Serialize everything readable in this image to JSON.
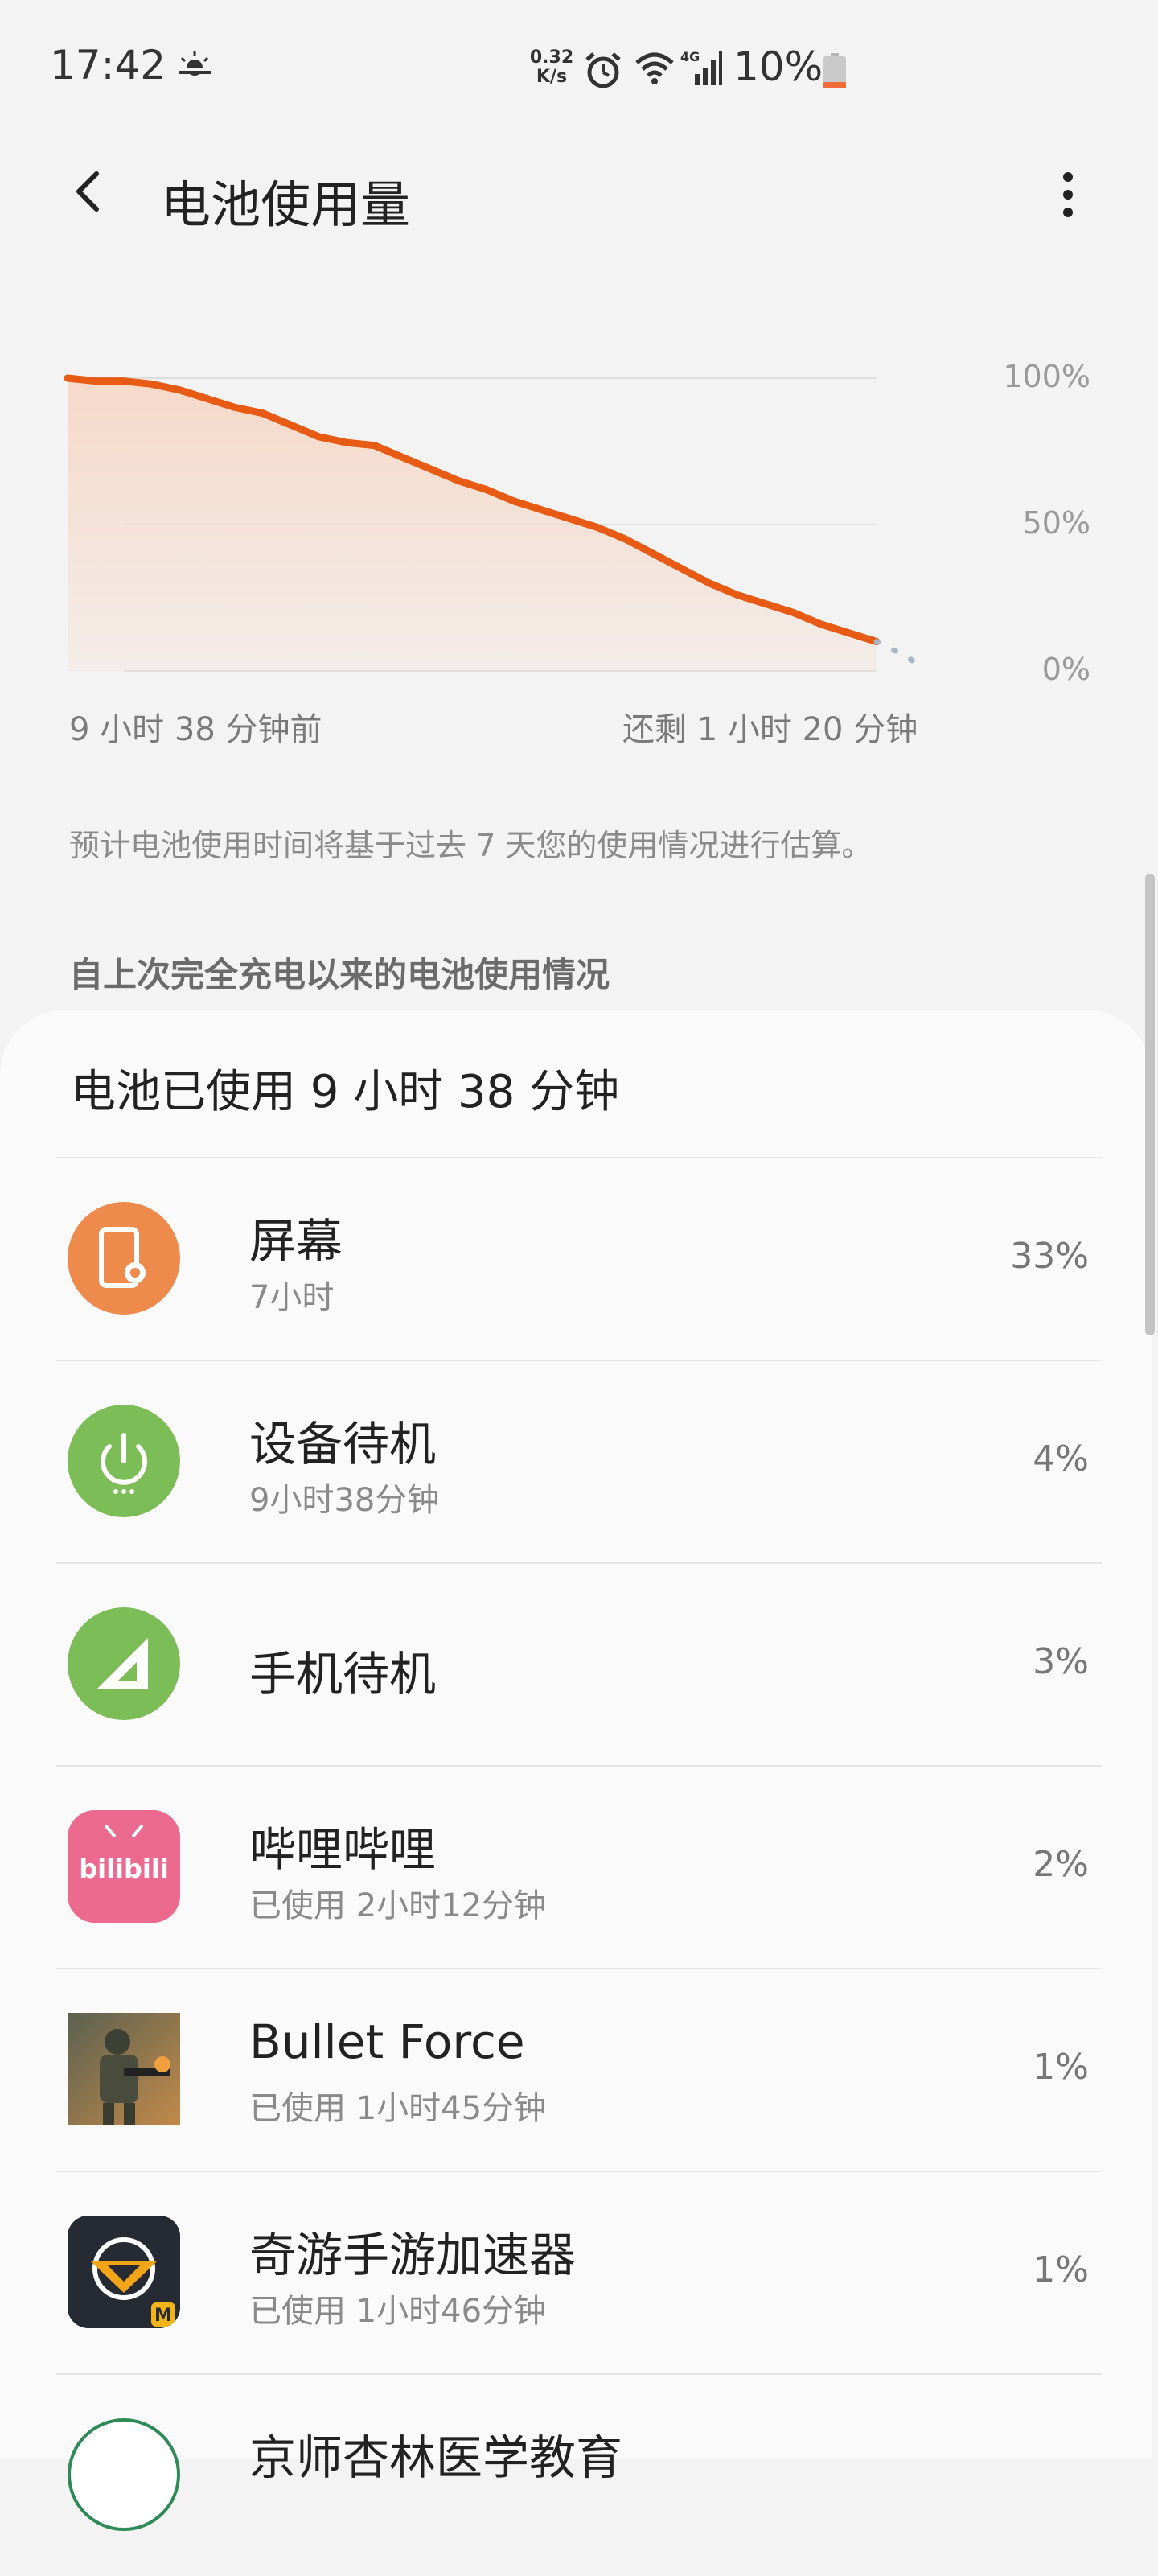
{
  "status_bar": {
    "time": "17:42",
    "net_speed_value": "0.32",
    "net_speed_unit": "K/s",
    "battery_percent": "10%",
    "network": "4G"
  },
  "header": {
    "title": "电池使用量"
  },
  "chart_data": {
    "type": "area",
    "y_ticks": [
      "100%",
      "50%",
      "0%"
    ],
    "ylim": [
      0,
      100
    ],
    "x_start_label": "9 小时 38 分钟前",
    "x_end_label": "还剩 1 小时 20 分钟",
    "series": [
      {
        "values": [
          100,
          99,
          99,
          98,
          96,
          93,
          90,
          88,
          84,
          80,
          78,
          77,
          73,
          69,
          65,
          62,
          58,
          55,
          52,
          49,
          45,
          40,
          35,
          30,
          26,
          23,
          20,
          16,
          13,
          10
        ]
      }
    ],
    "projection": [
      10,
      6,
      1
    ],
    "colors": {
      "line": "#e85b14",
      "fill_top": "#f6d9c9",
      "projection": "#a9b6c6"
    }
  },
  "note": "预计电池使用时间将基于过去 7 天您的使用情况进行估算。",
  "section_title": "自上次完全充电以来的电池使用情况",
  "usage": {
    "total": "电池已使用 9 小时 38 分钟",
    "items": [
      {
        "name": "屏幕",
        "sub": "7小时",
        "pct": "33%",
        "icon": "screen-icon"
      },
      {
        "name": "设备待机",
        "sub": "9小时38分钟",
        "pct": "4%",
        "icon": "power-icon"
      },
      {
        "name": "手机待机",
        "sub": "",
        "pct": "3%",
        "icon": "signal-icon"
      },
      {
        "name": "哔哩哔哩",
        "sub": "已使用 2小时12分钟",
        "pct": "2%",
        "icon": "bilibili-icon",
        "icon_text": "bilibili"
      },
      {
        "name": "Bullet Force",
        "sub": "已使用 1小时45分钟",
        "pct": "1%",
        "icon": "bullet-force-icon"
      },
      {
        "name": "奇游手游加速器",
        "sub": "已使用 1小时46分钟",
        "pct": "1%",
        "icon": "qiyou-icon",
        "icon_text": "M"
      },
      {
        "name": "京师杏林医学教育",
        "sub": "",
        "pct": "",
        "icon": "jingshi-icon"
      }
    ]
  }
}
